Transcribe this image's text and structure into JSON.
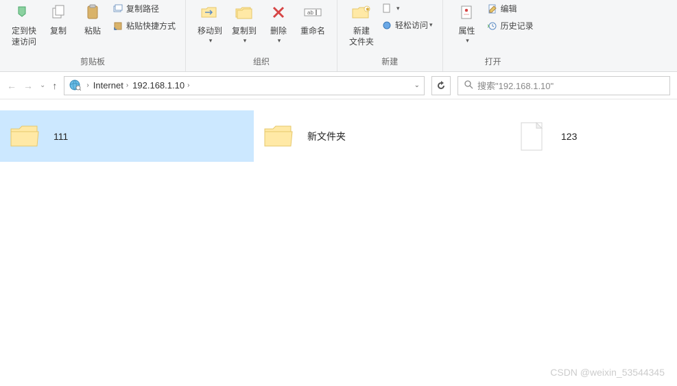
{
  "ribbon": {
    "clipboard": {
      "label": "剪贴板",
      "pin_to_quick": "定到快\n速访问",
      "copy": "复制",
      "paste": "粘贴",
      "copy_path": "复制路径",
      "paste_shortcut": "粘贴快捷方式"
    },
    "organize": {
      "label": "组织",
      "move_to": "移动到",
      "copy_to": "复制到",
      "delete": "删除",
      "rename": "重命名"
    },
    "new": {
      "label": "新建",
      "new_folder": "新建\n文件夹",
      "easy_access": "轻松访问"
    },
    "open": {
      "label": "打开",
      "properties": "属性",
      "edit": "编辑",
      "history": "历史记录"
    }
  },
  "address": {
    "crumbs": [
      "Internet",
      "192.168.1.10"
    ]
  },
  "search": {
    "placeholder": "搜索\"192.168.1.10\""
  },
  "items": [
    {
      "name": "111",
      "type": "folder",
      "selected": true
    },
    {
      "name": "新文件夹",
      "type": "folder",
      "selected": false
    },
    {
      "name": "123",
      "type": "file",
      "selected": false
    }
  ],
  "watermark": "CSDN @weixin_53544345"
}
